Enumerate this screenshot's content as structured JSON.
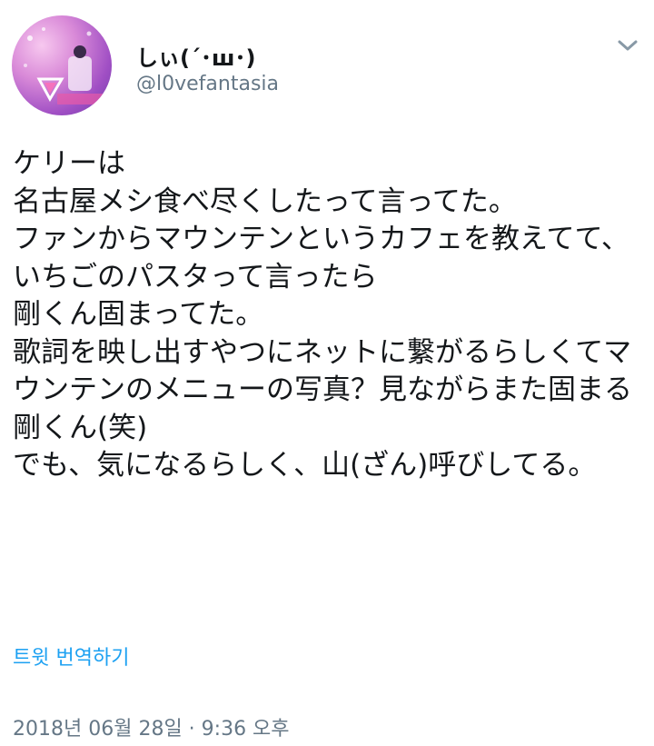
{
  "user": {
    "display_name": "しぃ(´･ш･)",
    "handle": "@l0vefantasia"
  },
  "tweet": {
    "text": "ケリーは\n名古屋メシ食べ尽くしたって言ってた。\nファンからマウンテンというカフェを教えてて、\nいちごのパスタって言ったら\n剛くん固まってた。\n歌詞を映し出すやつにネットに繋がるらしくてマウンテンのメニューの写真？見ながらまた固まる剛くん(笑)\nでも、気になるらしく、山(ざん)呼びしてる。",
    "translate_label": "트윗 번역하기",
    "timestamp": "2018년 06월 28일 · 9:36 오후"
  },
  "icons": {
    "menu": "chevron-down-icon"
  },
  "colors": {
    "link": "#1da1f2",
    "secondary_text": "#657786",
    "primary_text": "#14171a"
  }
}
